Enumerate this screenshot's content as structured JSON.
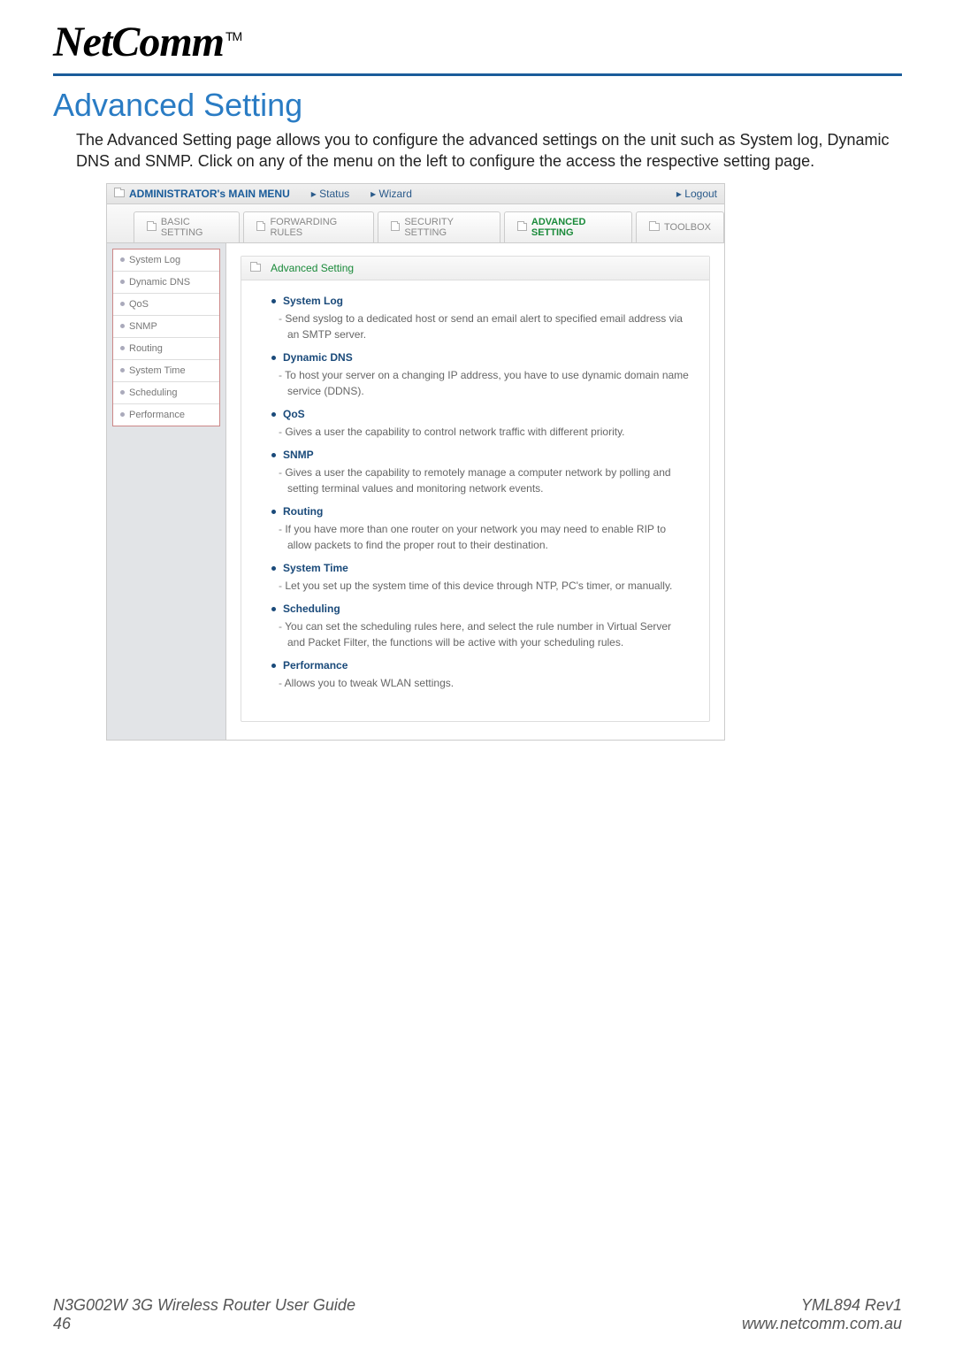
{
  "logo": {
    "text": "NetComm",
    "tm": "TM"
  },
  "page_title": "Advanced Setting",
  "intro": "The Advanced Setting page allows you to configure the advanced settings on the unit such as System log, Dynamic DNS and SNMP. Click on any of the menu on the left to configure the access the respective setting page.",
  "screenshot": {
    "topbar": {
      "mainmenu": "ADMINISTRATOR's MAIN MENU",
      "status": "Status",
      "wizard": "Wizard",
      "logout": "Logout"
    },
    "tabs": {
      "basic": "BASIC SETTING",
      "forwarding": "FORWARDING RULES",
      "security": "SECURITY SETTING",
      "advanced": "ADVANCED SETTING",
      "toolbox": "TOOLBOX"
    },
    "sidebar": [
      "System Log",
      "Dynamic DNS",
      "QoS",
      "SNMP",
      "Routing",
      "System Time",
      "Scheduling",
      "Performance"
    ],
    "content": {
      "title": "Advanced Setting",
      "items": [
        {
          "topic": "System Log",
          "desc": "Send syslog to a dedicated host or send an email alert to specified email address via an SMTP server."
        },
        {
          "topic": "Dynamic DNS",
          "desc": "To host your server on a changing IP address, you have to use dynamic domain name service (DDNS)."
        },
        {
          "topic": "QoS",
          "desc": "Gives a user the capability to control network traffic with different priority."
        },
        {
          "topic": "SNMP",
          "desc": "Gives a user the capability to remotely manage a computer network by polling and setting terminal values and monitoring network events."
        },
        {
          "topic": "Routing",
          "desc": "If you have more than one router on your network you may need to enable RIP to allow packets to find the proper rout to their destination."
        },
        {
          "topic": "System Time",
          "desc": "Let you set up the system time of this device through NTP, PC's timer, or manually."
        },
        {
          "topic": "Scheduling",
          "desc": "You can set the scheduling rules here, and select the rule number in Virtual Server and Packet Filter, the functions will be active with your scheduling rules."
        },
        {
          "topic": "Performance",
          "desc": "Allows you to tweak WLAN settings."
        }
      ]
    }
  },
  "footer": {
    "guide_title": "N3G002W 3G Wireless Router User Guide",
    "page_number": "46",
    "doc_rev": "YML894 Rev1",
    "url": "www.netcomm.com.au"
  }
}
